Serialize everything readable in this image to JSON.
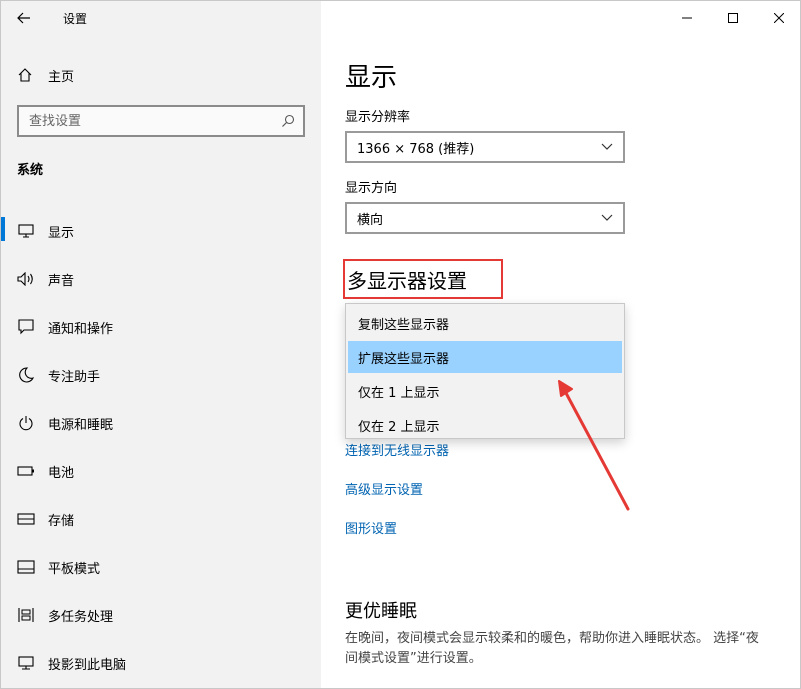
{
  "window": {
    "title": "设置"
  },
  "sidebar": {
    "home_label": "主页",
    "search_placeholder": "查找设置",
    "section_title": "系统",
    "items": [
      {
        "label": "显示",
        "icon": "monitor-icon",
        "active": true
      },
      {
        "label": "声音",
        "icon": "speaker-icon"
      },
      {
        "label": "通知和操作",
        "icon": "message-icon"
      },
      {
        "label": "专注助手",
        "icon": "moon-icon"
      },
      {
        "label": "电源和睡眠",
        "icon": "power-icon"
      },
      {
        "label": "电池",
        "icon": "battery-icon"
      },
      {
        "label": "存储",
        "icon": "storage-icon"
      },
      {
        "label": "平板模式",
        "icon": "tablet-icon"
      },
      {
        "label": "多任务处理",
        "icon": "multitask-icon"
      },
      {
        "label": "投影到此电脑",
        "icon": "project-icon"
      }
    ]
  },
  "main": {
    "title": "显示",
    "resolution_label": "显示分辨率",
    "resolution_value": "1366 × 768 (推荐)",
    "orientation_label": "显示方向",
    "orientation_value": "横向",
    "multi_display_heading": "多显示器设置",
    "multi_display_options": [
      "复制这些显示器",
      "扩展这些显示器",
      "仅在 1 上显示",
      "仅在 2 上显示"
    ],
    "multi_display_selected": "扩展这些显示器",
    "links": [
      "连接到无线显示器",
      "高级显示设置",
      "图形设置"
    ],
    "sleep_heading": "更优睡眠",
    "sleep_desc": "在晚间，夜间模式会显示较柔和的暖色，帮助你进入睡眠状态。 选择“夜间模式设置”进行设置。"
  },
  "colors": {
    "accent": "#0078d7",
    "link": "#0063b1",
    "highlight_box": "#e53935",
    "arrow": "#e53935",
    "selected_item": "#99d1ff"
  }
}
